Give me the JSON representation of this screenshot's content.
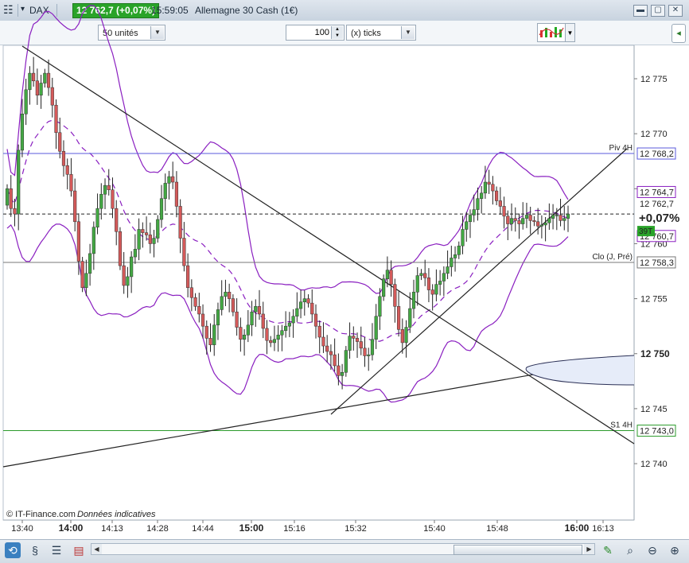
{
  "header": {
    "instrument": "DAX",
    "price_change": "12 762,7 (+0,07%)",
    "time": "15:59:05",
    "market_name": "Allemagne 30 Cash (1€)"
  },
  "toolbar": {
    "size_label": "50 unités",
    "ticks_value": "100",
    "ticks_label": "(x) ticks"
  },
  "colors": {
    "up": "#43a843",
    "down": "#d45a5a",
    "bollinger": "#8a1fc0",
    "pivot": "#5a5adc",
    "support": "#2b9a2b",
    "accent_badge": "#29a329"
  },
  "chart_data": {
    "type": "candlestick",
    "x_ticks": [
      "13:40",
      "14:00",
      "14:13",
      "14:28",
      "14:44",
      "15:00",
      "15:16",
      "15:32",
      "15:40",
      "15:48",
      "16:00",
      "16:13"
    ],
    "x_bold_ticks": [
      "14:00",
      "15:00",
      "16:00"
    ],
    "y_ticks": [
      "12 775",
      "12 770",
      "12 765",
      "12 760",
      "12 755",
      "12 750",
      "12 745",
      "12 740"
    ],
    "ylim": [
      12738,
      12781
    ],
    "levels": [
      {
        "label": "Piv 4H",
        "value": "12 768,2",
        "y": 12768.2
      },
      {
        "label": "Clo (J, Pré)",
        "value": "12 758,3",
        "y": 12758.3
      },
      {
        "label": "S1 4H",
        "value": "12 743,0",
        "y": 12743.0
      }
    ],
    "bollinger_labels": {
      "upper": "12 764,7",
      "lower": "12 760,7"
    },
    "last_price": "12 762,7",
    "last_change": "+0,07%",
    "volume_badge": "39T",
    "closes": [
      12765.0,
      12763.2,
      12762.7,
      12768.5,
      12771.8,
      12774.0,
      12775.5,
      12774.8,
      12773.5,
      12774.6,
      12775.5,
      12774.2,
      12772.6,
      12770.1,
      12768.4,
      12767.1,
      12766.3,
      12764.8,
      12762.0,
      12758.4,
      12756.0,
      12757.3,
      12759.1,
      12761.5,
      12763.2,
      12764.5,
      12765.3,
      12764.9,
      12763.2,
      12761.1,
      12758.0,
      12756.2,
      12757.0,
      12758.8,
      12759.5,
      12761.3,
      12761.0,
      12760.8,
      12760.0,
      12760.5,
      12762.2,
      12764.1,
      12765.5,
      12766.1,
      12765.6,
      12763.4,
      12760.5,
      12758.0,
      12756.0,
      12755.1,
      12754.3,
      12753.6,
      12752.5,
      12751.4,
      12750.8,
      12752.6,
      12754.0,
      12755.2,
      12755.6,
      12755.0,
      12753.8,
      12752.4,
      12751.3,
      12751.7,
      12752.6,
      12753.8,
      12754.3,
      12753.6,
      12752.3,
      12751.2,
      12751.0,
      12751.3,
      12751.7,
      12752.1,
      12752.5,
      12752.8,
      12753.4,
      12754.1,
      12754.7,
      12755.0,
      12754.6,
      12753.6,
      12752.5,
      12751.5,
      12750.7,
      12750.2,
      12749.9,
      12748.9,
      12748.0,
      12748.3,
      12750.3,
      12751.6,
      12751.4,
      12751.1,
      12750.5,
      12749.8,
      12749.9,
      12751.3,
      12753.4,
      12755.2,
      12756.8,
      12757.6,
      12756.3,
      12754.3,
      12752.2,
      12751.0,
      12752.4,
      12754.1,
      12755.6,
      12757.1,
      12757.3,
      12756.9,
      12755.8,
      12755.4,
      12756.3,
      12756.6,
      12757.3,
      12757.9,
      12758.7,
      12759.0,
      12759.8,
      12761.3,
      12762.0,
      12762.6,
      12763.1,
      12764.1,
      12764.6,
      12765.6,
      12765.4,
      12764.8,
      12763.9,
      12763.4,
      12762.5,
      12761.8,
      12762.3,
      12762.1,
      12761.8,
      12762.3,
      12762.6,
      12762.1,
      12762.0,
      12761.6,
      12761.7,
      12761.9,
      12762.3,
      12762.6,
      12762.6,
      12762.1,
      12762.3,
      12762.7
    ]
  },
  "footer": {
    "copyright": "© IT-Finance.com",
    "note": "Données indicatives"
  }
}
